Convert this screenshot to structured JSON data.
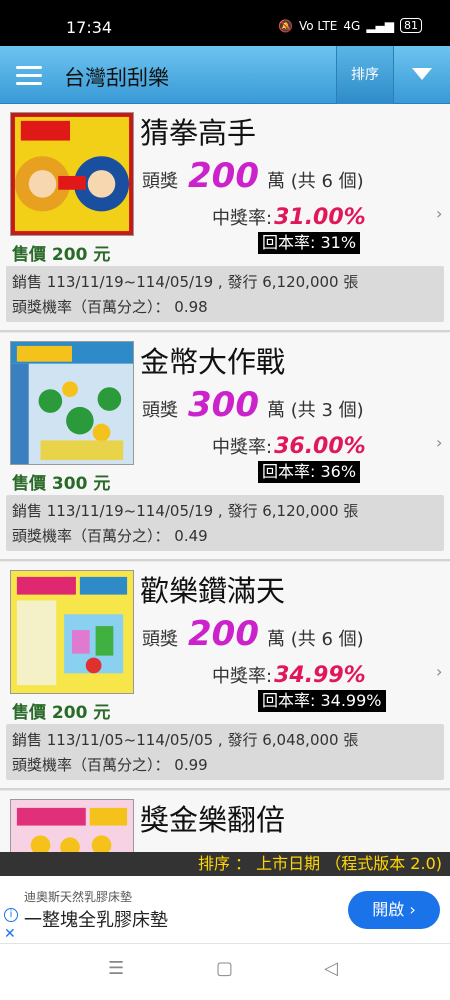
{
  "status": {
    "time": "17:34",
    "signal_text": "Vo LTE",
    "network": "4G",
    "battery": "81"
  },
  "appbar": {
    "title": "台灣刮刮樂",
    "sort_label": "排序"
  },
  "cards": [
    {
      "name": "猜拳高手",
      "prize_label": "頭獎",
      "prize_amount": "200",
      "prize_unit": "萬 (共 6 個)",
      "win_label": "中獎率:",
      "win_value": "31.00%",
      "return_text": "回本率: 31%",
      "price_text": "售價 200 元",
      "sales_text": "銷售 113/11/19~114/05/19 , 發行 6,120,000 張",
      "odds_text": "頭獎機率（百萬分之）： 0.98",
      "thumb_title": "猜拳高手"
    },
    {
      "name": "金幣大作戰",
      "prize_label": "頭獎",
      "prize_amount": "300",
      "prize_unit": "萬 (共 3 個)",
      "win_label": "中獎率:",
      "win_value": "36.00%",
      "return_text": "回本率: 36%",
      "price_text": "售價 300 元",
      "sales_text": "銷售 113/11/19~114/05/19 , 發行 6,120,000 張",
      "odds_text": "頭獎機率（百萬分之）： 0.49",
      "thumb_title": "金幣大作戰"
    },
    {
      "name": "歡樂鑽滿天",
      "prize_label": "頭獎",
      "prize_amount": "200",
      "prize_unit": "萬 (共 6 個)",
      "win_label": "中獎率:",
      "win_value": "34.99%",
      "return_text": "回本率: 34.99%",
      "price_text": "售價 200 元",
      "sales_text": "銷售 113/11/05~114/05/05 , 發行 6,048,000 張",
      "odds_text": "頭獎機率（百萬分之）： 0.99",
      "thumb_title": "歡樂鑽滿天"
    },
    {
      "name": "獎金樂翻倍",
      "thumb_title": "獎金樂翻倍"
    }
  ],
  "sortbar_text": "排序 ： 上市日期 （程式版本 2.0)",
  "ad": {
    "advertiser": "迪奧斯天然乳膠床墊",
    "headline": "一整塊全乳膠床墊",
    "cta": "開啟 ›"
  },
  "colors": {
    "appbar": "#3a9ad6",
    "prize": "#cc22cc",
    "win_rate": "#e0185a",
    "price": "#2a6a28",
    "cta": "#1a73e8"
  }
}
